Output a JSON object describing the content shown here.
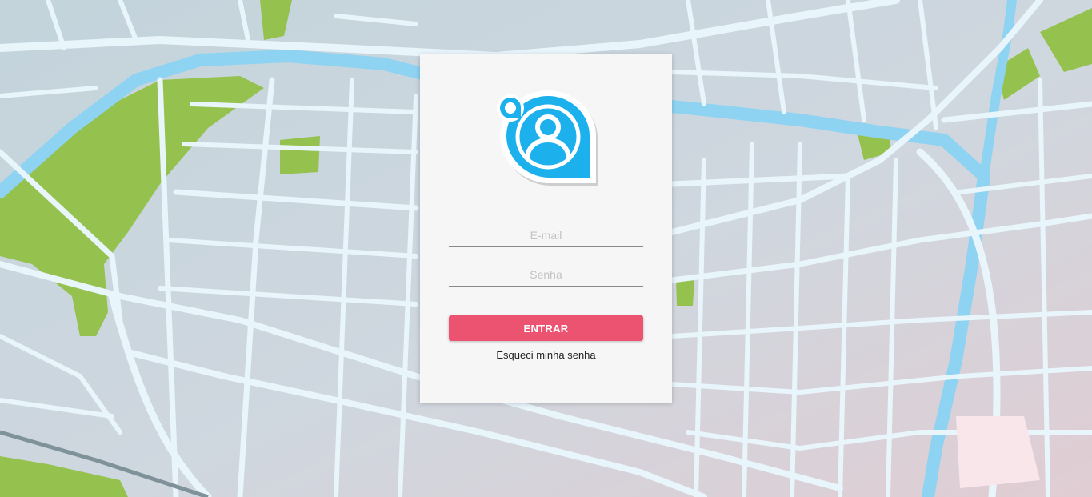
{
  "login": {
    "email_placeholder": "E-mail",
    "password_placeholder": "Senha",
    "submit_label": "ENTRAR",
    "forgot_label": "Esqueci minha senha"
  },
  "colors": {
    "accent": "#ec5371",
    "logo_blue": "#1cb1ec",
    "card": "#f6f6f6",
    "map_street": "#e6f4fb",
    "map_block": "#c7d5dd",
    "map_park": "#95c24f",
    "map_river": "#8fd3f2"
  },
  "icons": {
    "logo": "user-location-pin-icon"
  }
}
